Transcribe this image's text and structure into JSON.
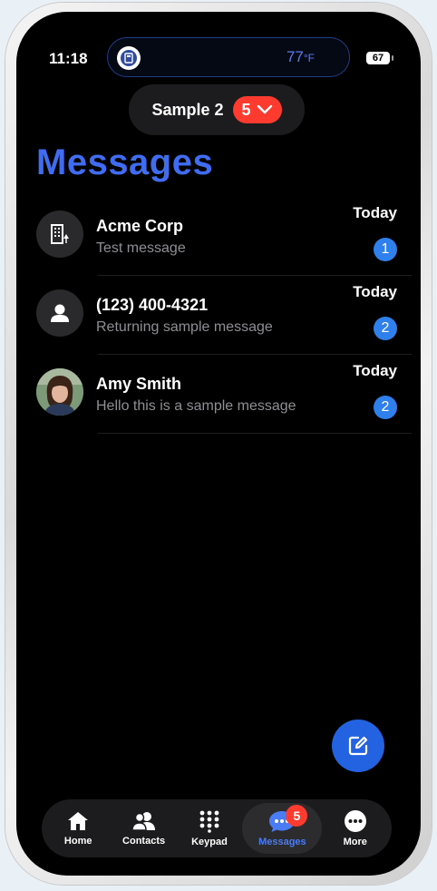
{
  "status_bar": {
    "time": "11:18",
    "temperature": "77",
    "temp_unit": "°F",
    "battery": "67"
  },
  "account": {
    "name": "Sample 2",
    "badge_count": "5"
  },
  "page_title": "Messages",
  "conversations": [
    {
      "name": "Acme Corp",
      "preview": "Test message",
      "time": "Today",
      "unread": "1",
      "avatar": "building-icon"
    },
    {
      "name": "(123) 400-4321",
      "preview": "Returning sample message",
      "time": "Today",
      "unread": "2",
      "avatar": "person-icon"
    },
    {
      "name": "Amy Smith",
      "preview": "Hello this is a sample message",
      "time": "Today",
      "unread": "2",
      "avatar": "photo"
    }
  ],
  "tabs": [
    {
      "label": "Home",
      "icon": "home-icon"
    },
    {
      "label": "Contacts",
      "icon": "contacts-icon"
    },
    {
      "label": "Keypad",
      "icon": "keypad-icon"
    },
    {
      "label": "Messages",
      "icon": "messages-icon",
      "badge": "5",
      "active": true
    },
    {
      "label": "More",
      "icon": "more-icon"
    }
  ],
  "colors": {
    "accent": "#3f6cf0",
    "badge": "#ff3b30",
    "unread": "#2f80ed",
    "fab": "#2362e0"
  }
}
